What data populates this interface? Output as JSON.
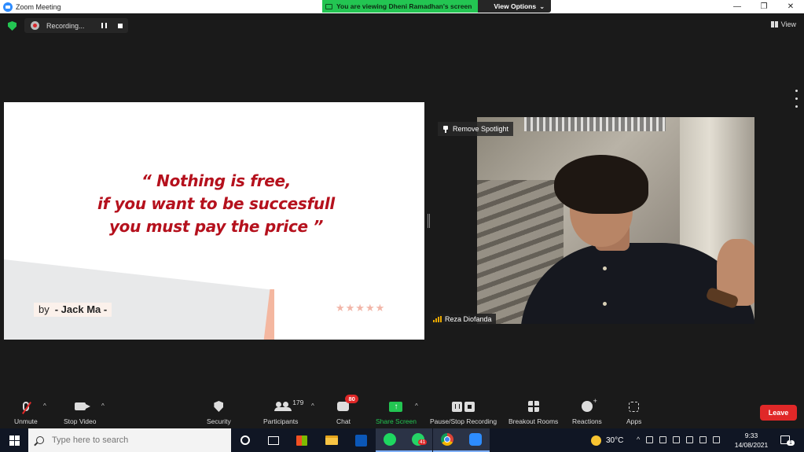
{
  "window": {
    "title": "Zoom Meeting",
    "controls": [
      "—",
      "❐",
      "✕"
    ]
  },
  "banner": {
    "viewing": "You are viewing Dheni Ramadhan's screen",
    "options": "View Options",
    "options_caret": "⌄"
  },
  "recording": {
    "label": "Recording..."
  },
  "view_button": "View",
  "slide": {
    "quote_line1": "“ Nothing is free,",
    "quote_line2": "if you want to be succesfull",
    "quote_line3": "you must pay the price ”",
    "by": "by",
    "author": "- Jack Ma -",
    "stars": "★★★★★",
    "colors": {
      "quote": "#b5111d",
      "accent": "#f4b7a0"
    }
  },
  "video": {
    "spotlight_action": "Remove Spotlight",
    "participant_name": "Reza Diofanda"
  },
  "toolbar": {
    "unmute": "Unmute",
    "stop_video": "Stop Video",
    "security": "Security",
    "participants": "Participants",
    "participant_count": "179",
    "chat": "Chat",
    "chat_badge": "80",
    "share_screen": "Share Screen",
    "share_arrow": "↑",
    "pause_stop_recording": "Pause/Stop Recording",
    "breakout_rooms": "Breakout Rooms",
    "reactions": "Reactions",
    "apps": "Apps",
    "leave": "Leave",
    "caret": "^",
    "colors": {
      "share": "#23c552",
      "leave": "#e02828",
      "badge": "#e02828"
    }
  },
  "taskbar": {
    "search_placeholder": "Type here to search",
    "whatsapp_badge": "41",
    "weather": "30°C",
    "time": "9:33",
    "date": "14/08/2021",
    "notification_count": "1",
    "tray_caret": "^"
  }
}
